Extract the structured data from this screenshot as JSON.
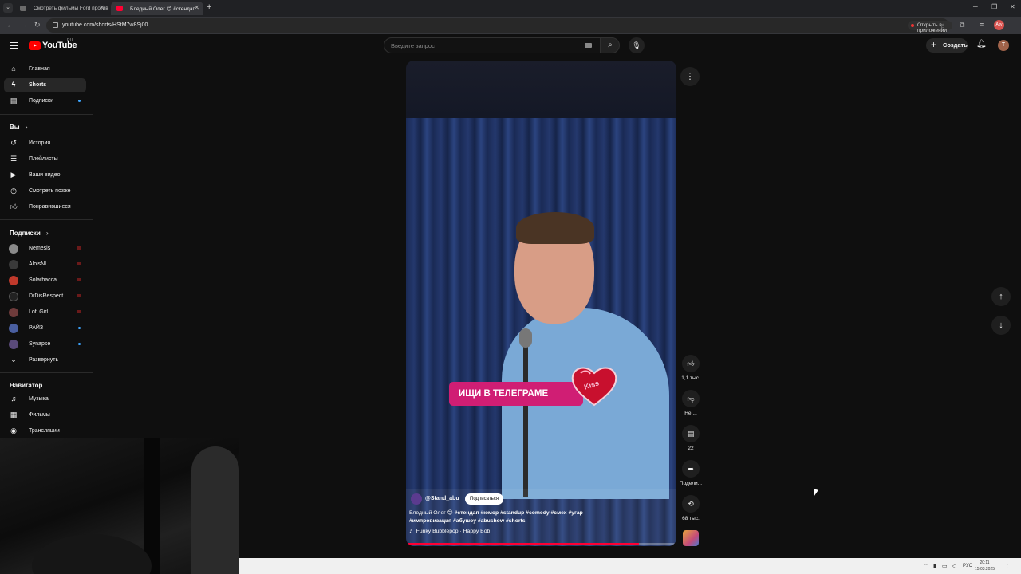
{
  "browser": {
    "tabs": [
      {
        "title": "Смотреть фильмы Ford против",
        "favicon_color": "#6b6b6b",
        "active": false
      },
      {
        "title": "Бледный Олег 😊 #стендап",
        "favicon_color": "#ff0033",
        "active": true
      }
    ],
    "url": "youtube.com/shorts/HStM7w8Sj00",
    "open_in_app": "Открыть в приложении",
    "profile": "Аку"
  },
  "masthead": {
    "logo_text": "YouTube",
    "region": "RU",
    "search_placeholder": "Введите запрос",
    "create_label": "Создать",
    "avatar_letter": "T"
  },
  "sidebar": {
    "main": [
      {
        "label": "Главная",
        "icon": "home-icon"
      },
      {
        "label": "Shorts",
        "icon": "shorts-icon",
        "active": true
      },
      {
        "label": "Подписки",
        "icon": "subscriptions-icon"
      }
    ],
    "you_header": "Вы",
    "you": [
      {
        "label": "История",
        "icon": "history-icon"
      },
      {
        "label": "Плейлисты",
        "icon": "playlists-icon"
      },
      {
        "label": "Ваши видео",
        "icon": "your-videos-icon"
      },
      {
        "label": "Смотреть позже",
        "icon": "watch-later-icon"
      },
      {
        "label": "Понравившиеся",
        "icon": "liked-icon"
      }
    ],
    "subs_header": "Подписки",
    "subs": [
      {
        "label": "Nemesis",
        "color": "#8a8a8a",
        "badge": "live"
      },
      {
        "label": "AloisNL",
        "color": "#3a3a3a",
        "badge": "live"
      },
      {
        "label": "Solarbacca",
        "color": "#c0392b",
        "badge": "live"
      },
      {
        "label": "DrDisRespect",
        "color": "#222222",
        "badge": "live"
      },
      {
        "label": "Lofi Girl",
        "color": "#6e3b3b",
        "badge": "live"
      },
      {
        "label": "РАЙЗ",
        "color": "#4a5fa0",
        "badge": "dot"
      },
      {
        "label": "Synapse",
        "color": "#5a4a7a",
        "badge": "dot"
      }
    ],
    "expand_label": "Развернуть",
    "nav_header": "Навигатор",
    "nav": [
      {
        "label": "Музыка",
        "icon": "music-icon"
      },
      {
        "label": "Фильмы",
        "icon": "movies-icon"
      },
      {
        "label": "Трансляции",
        "icon": "live-icon"
      }
    ]
  },
  "short": {
    "banner_text": "ИЩИ В ТЕЛЕГРАМЕ",
    "heart_text": "Kiss",
    "channel": "@Stand_abu",
    "subscribe_label": "Подписаться",
    "title_plain": "Бледный Олег 😊 ",
    "title_tags": "#стендап #юмор #standup #comedy #смех #угар #импровизация #абушоу #abushow #shorts",
    "sound": "♬ Funky Bubblepop · Happy Bob",
    "progress": 0.86
  },
  "actions": {
    "like_count": "1,1 тыс.",
    "dislike_label": "Не ...",
    "comments_count": "22",
    "share_label": "Подели...",
    "remix_count": "68 тыс."
  },
  "taskbar": {
    "lang": "РУС",
    "time": "20:11",
    "date": "15.03.2025"
  }
}
